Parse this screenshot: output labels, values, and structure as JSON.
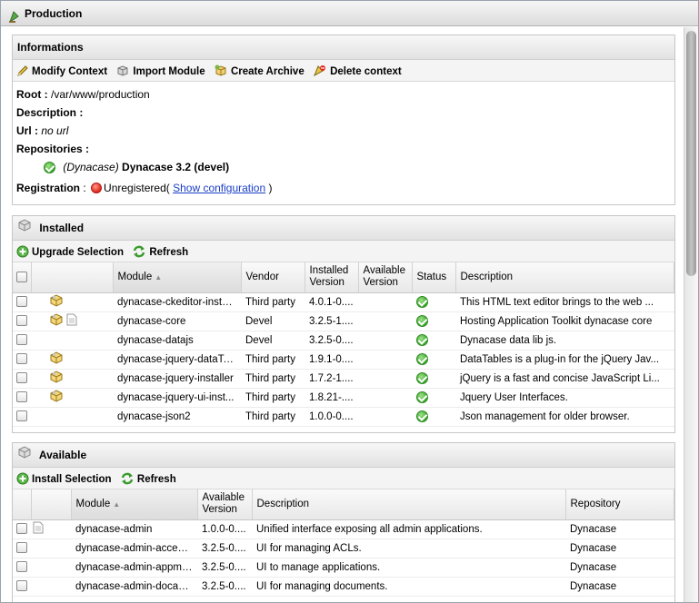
{
  "window": {
    "title": "Production"
  },
  "informations": {
    "title": "Informations",
    "toolbar": {
      "modify": "Modify Context",
      "import": "Import Module",
      "archive": "Create Archive",
      "delete": "Delete context"
    },
    "root_label": "Root :",
    "root_value": "/var/www/production",
    "description_label": "Description :",
    "url_label": "Url :",
    "url_value": "no url",
    "repositories_label": "Repositories :",
    "repo_prefix": "(Dynacase)",
    "repo_name": "Dynacase 3.2 (devel)",
    "registration_label": "Registration",
    "registration_sep": ":",
    "registration_status": "Unregistered(",
    "registration_link": "Show configuration",
    "registration_close": ")"
  },
  "installed": {
    "title": "Installed",
    "toolbar": {
      "upgrade": "Upgrade Selection",
      "refresh": "Refresh"
    },
    "columns": {
      "module": "Module",
      "vendor": "Vendor",
      "installed_version": "Installed Version",
      "available_version": "Available Version",
      "status": "Status",
      "description": "Description"
    },
    "rows": [
      {
        "module": "dynacase-ckeditor-instal...",
        "vendor": "Third party",
        "version": "4.0.1-0....",
        "description": "This HTML text editor brings to the web ...",
        "icons": [
          "package-icon"
        ]
      },
      {
        "module": "dynacase-core",
        "vendor": "Devel",
        "version": "3.2.5-1....",
        "description": "Hosting Application Toolkit dynacase core",
        "icons": [
          "package-icon",
          "document-icon"
        ]
      },
      {
        "module": "dynacase-datajs",
        "vendor": "Devel",
        "version": "3.2.5-0....",
        "description": "Dynacase data lib js.",
        "icons": []
      },
      {
        "module": "dynacase-jquery-dataTa...",
        "vendor": "Third party",
        "version": "1.9.1-0....",
        "description": "DataTables is a plug-in for the jQuery Jav...",
        "icons": [
          "package-icon"
        ]
      },
      {
        "module": "dynacase-jquery-installer",
        "vendor": "Third party",
        "version": "1.7.2-1....",
        "description": "jQuery is a fast and concise JavaScript Li...",
        "icons": [
          "package-icon"
        ]
      },
      {
        "module": "dynacase-jquery-ui-inst...",
        "vendor": "Third party",
        "version": "1.8.21-....",
        "description": "Jquery User Interfaces.",
        "icons": [
          "package-icon"
        ]
      },
      {
        "module": "dynacase-json2",
        "vendor": "Third party",
        "version": "1.0.0-0....",
        "description": "Json management for older browser.",
        "icons": []
      }
    ]
  },
  "available": {
    "title": "Available",
    "toolbar": {
      "install": "Install Selection",
      "refresh": "Refresh"
    },
    "columns": {
      "module": "Module",
      "available_version": "Available Version",
      "description": "Description",
      "repository": "Repository"
    },
    "rows": [
      {
        "module": "dynacase-admin",
        "version": "1.0.0-0....",
        "description": "Unified interface exposing all admin applications.",
        "repository": "Dynacase",
        "icons": [
          "document-icon"
        ]
      },
      {
        "module": "dynacase-admin-access...",
        "version": "3.2.5-0....",
        "description": "UI for managing ACLs.",
        "repository": "Dynacase",
        "icons": []
      },
      {
        "module": "dynacase-admin-appmn...",
        "version": "3.2.5-0....",
        "description": "UI to manage applications.",
        "repository": "Dynacase",
        "icons": []
      },
      {
        "module": "dynacase-admin-docad...",
        "version": "3.2.5-0....",
        "description": "UI for managing documents.",
        "repository": "Dynacase",
        "icons": []
      }
    ]
  },
  "colors": {
    "link": "#1a3ec8",
    "ok": "#3aa52b",
    "error": "#e0251a",
    "header_bg": "#e2e2e2"
  }
}
